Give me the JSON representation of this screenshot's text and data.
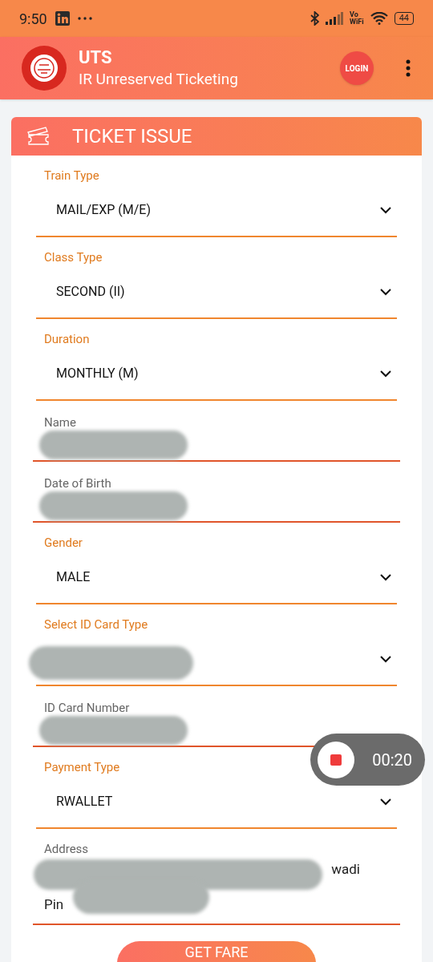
{
  "status_bar": {
    "time": "9:50",
    "vowifi": [
      "Vo",
      "WiFi"
    ],
    "battery": "44"
  },
  "app_bar": {
    "title": "UTS",
    "subtitle": "IR Unreserved Ticketing",
    "login": "LOGIN"
  },
  "card": {
    "title": "TICKET ISSUE",
    "fields": [
      {
        "kind": "select",
        "label": "Train Type",
        "value": "MAIL/EXP (M/E)",
        "redacted": false
      },
      {
        "kind": "select",
        "label": "Class Type",
        "value": "SECOND (II)",
        "redacted": false
      },
      {
        "kind": "select",
        "label": "Duration",
        "value": "MONTHLY (M)",
        "redacted": false
      },
      {
        "kind": "text",
        "label": "Name",
        "redacted": true
      },
      {
        "kind": "text",
        "label": "Date of Birth",
        "redacted": true
      },
      {
        "kind": "select",
        "label": "Gender",
        "value": "MALE",
        "redacted": false
      },
      {
        "kind": "select",
        "label": "Select ID Card Type",
        "redacted": true
      },
      {
        "kind": "text",
        "label": "ID Card Number",
        "redacted": true
      },
      {
        "kind": "select",
        "label": "Payment Type",
        "value": "RWALLET",
        "redacted": false
      },
      {
        "kind": "address",
        "label": "Address",
        "lines": [
          "wadi",
          "Pin"
        ],
        "redacted": true
      }
    ],
    "button": "GET FARE"
  },
  "recorder": {
    "time": "00:20"
  }
}
